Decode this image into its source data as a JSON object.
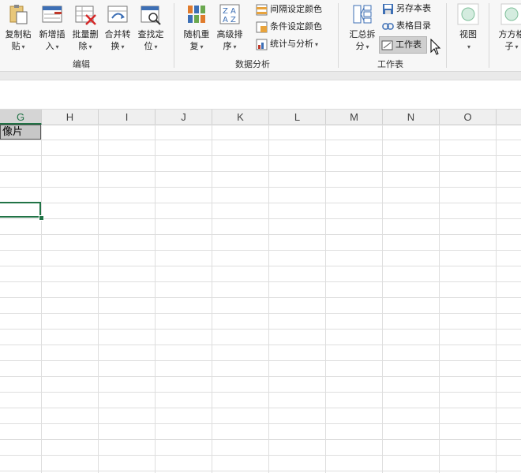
{
  "ribbon": {
    "groups": [
      {
        "label": "编辑"
      },
      {
        "label": "数据分析"
      },
      {
        "label": "工作表"
      }
    ],
    "edit_buttons": [
      {
        "line1": "复制粘",
        "line2": "贴"
      },
      {
        "line1": "新增插",
        "line2": "入"
      },
      {
        "line1": "批量删",
        "line2": "除"
      },
      {
        "line1": "合并转",
        "line2": "换"
      },
      {
        "line1": "查找定",
        "line2": "位"
      }
    ],
    "analysis_buttons": [
      {
        "line1": "随机重",
        "line2": "复"
      },
      {
        "line1": "高级排",
        "line2": "序"
      }
    ],
    "analysis_small": [
      {
        "label": "间隔设定颜色"
      },
      {
        "label": "条件设定颜色"
      },
      {
        "label": "统计与分析"
      }
    ],
    "sheet_big": {
      "line1": "汇总拆",
      "line2": "分"
    },
    "sheet_small": [
      {
        "label": "另存本表"
      },
      {
        "label": "表格目录"
      },
      {
        "label": "工作表"
      }
    ],
    "view_button": {
      "line1": "视图"
    },
    "fangfang_button": {
      "line1": "方方格",
      "line2": "子"
    },
    "colors": {
      "accent": "#217346",
      "ribbon_bg": "#f7f7f7"
    }
  },
  "sheet": {
    "columns": [
      "G",
      "H",
      "I",
      "J",
      "K",
      "L",
      "M",
      "N",
      "O"
    ],
    "selected_column": "G",
    "cell_g1": "像片"
  }
}
